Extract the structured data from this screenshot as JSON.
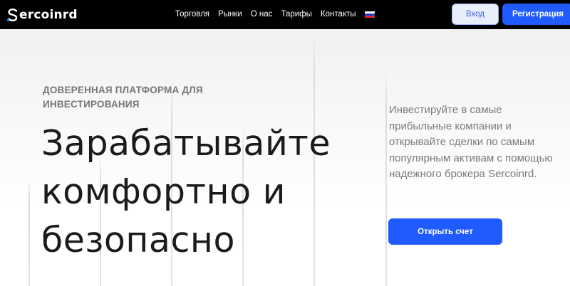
{
  "header": {
    "logo": {
      "initial": "S",
      "text": "ercoinrd"
    },
    "nav": [
      {
        "label": "Торговля"
      },
      {
        "label": "Рынки"
      },
      {
        "label": "О нас"
      },
      {
        "label": "Тарифы"
      },
      {
        "label": "Контакты"
      }
    ],
    "language_flag": {
      "name": "russia-flag-icon",
      "colors": [
        "#ffffff",
        "#1c3fc4",
        "#e0242c"
      ]
    },
    "login_label": "Вход",
    "register_label": "Регистрация"
  },
  "hero": {
    "eyebrow": "ДОВЕРЕННАЯ ПЛАТФОРМА ДЛЯ ИНВЕСТИРОВАНИЯ",
    "headline": "Зарабатывайте комфортно и безопасно",
    "description": "Инвестируйте в самые прибыльные компании и открывайте сделки по самым популярным активам с помощью надежного брокера Sercoinrd.",
    "cta_label": "Открыть счет"
  },
  "colors": {
    "accent": "#1f5bff",
    "header_bg": "#000000",
    "login_bg": "#e9eefb",
    "login_text": "#3d63dd"
  }
}
